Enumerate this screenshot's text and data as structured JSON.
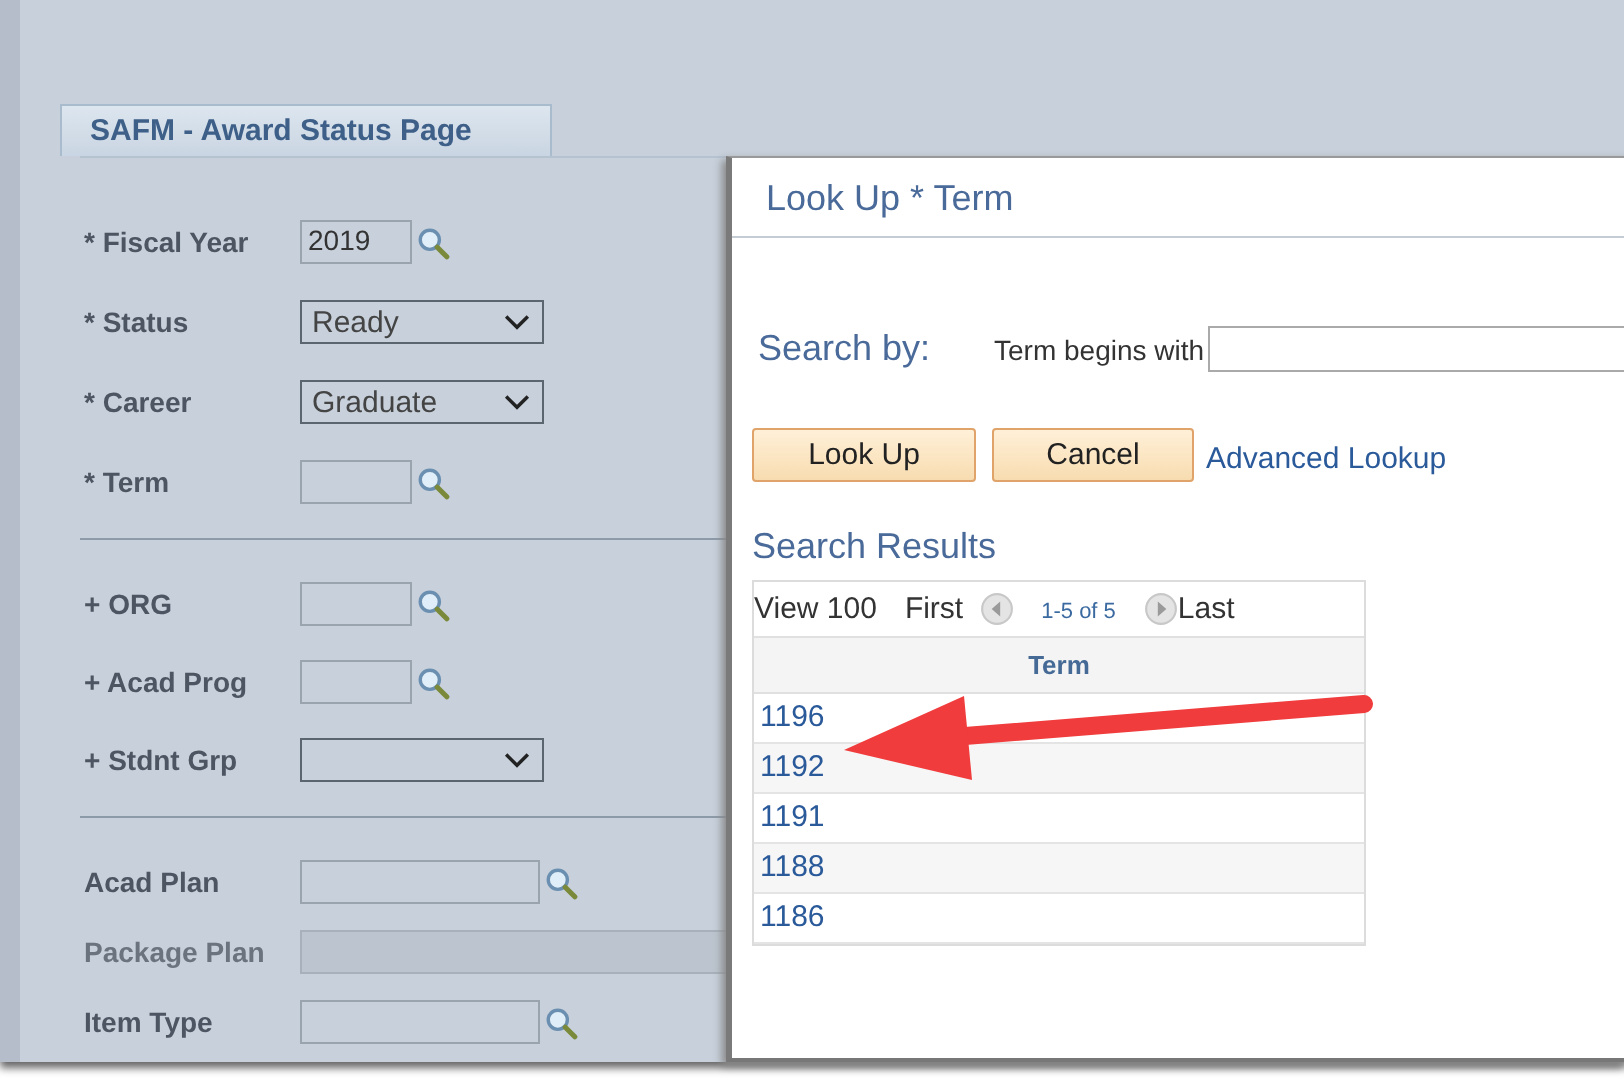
{
  "page": {
    "tab": "SAFM - Award Status Page",
    "groups": [
      [
        {
          "label": "* Fiscal Year",
          "kind": "lookup",
          "value": "2019"
        },
        {
          "label": "* Status",
          "kind": "select",
          "value": "Ready"
        },
        {
          "label": "* Career",
          "kind": "select",
          "value": "Graduate"
        },
        {
          "label": "* Term",
          "kind": "lookup"
        }
      ],
      [
        {
          "label": "+ ORG",
          "kind": "lookup"
        },
        {
          "label": "+ Acad Prog",
          "kind": "lookup"
        },
        {
          "label": "+ Stdnt Grp",
          "kind": "select"
        }
      ],
      [
        {
          "label": "Acad Plan",
          "kind": "lookup-wide"
        },
        {
          "label": "Package Plan",
          "kind": "disabled"
        },
        {
          "label": "Item Type",
          "kind": "lookup-wide"
        }
      ]
    ]
  },
  "dialog": {
    "title": "Look Up * Term",
    "search_by": "Search by:",
    "field_label": "Term begins with",
    "buttons": [
      "Look Up",
      "Cancel"
    ],
    "link": "Advanced Lookup",
    "results_title": "Search Results",
    "nav": {
      "view": "View 100",
      "first": "First",
      "range": "1-5 of 5",
      "last": "Last"
    },
    "column": "Term",
    "rows": [
      "1196",
      "1192",
      "1191",
      "1188",
      "1186"
    ]
  }
}
